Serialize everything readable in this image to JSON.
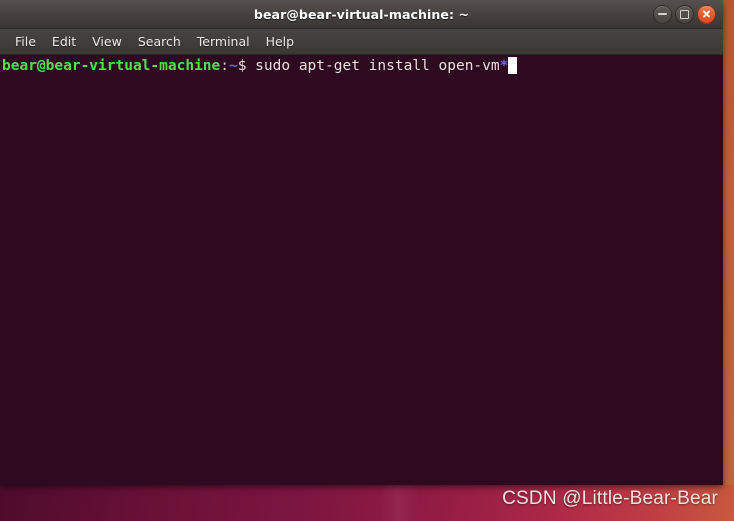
{
  "window": {
    "title": "bear@bear-virtual-machine: ~",
    "controls": {
      "minimize_label": "Minimize",
      "maximize_label": "Maximize",
      "close_label": "Close"
    }
  },
  "menubar": {
    "items": [
      {
        "label": "File"
      },
      {
        "label": "Edit"
      },
      {
        "label": "View"
      },
      {
        "label": "Search"
      },
      {
        "label": "Terminal"
      },
      {
        "label": "Help"
      }
    ]
  },
  "terminal": {
    "prompt": {
      "user_host": "bear@bear-virtual-machine",
      "separator": ":",
      "path": "~",
      "symbol": "$"
    },
    "command": " sudo apt-get install open-vm",
    "command_glob": "*",
    "cursor": "block"
  },
  "watermark": {
    "text": "CSDN @Little-Bear-Bear"
  },
  "colors": {
    "terminal_background": "#2d0a20",
    "prompt_green": "#4ee24e",
    "prompt_blue": "#6a6ce6",
    "titlebar_gray": "#4b4644",
    "close_button_orange": "#e4582b",
    "desktop_magenta": "#931c44",
    "desktop_orange_edge": "#c0663c"
  }
}
